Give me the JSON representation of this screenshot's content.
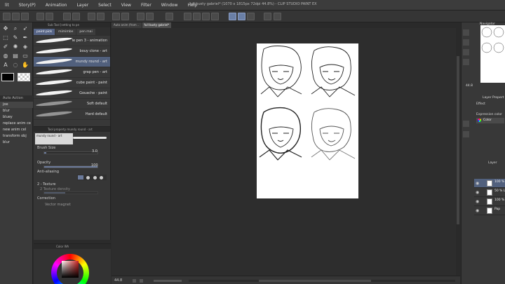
{
  "app": {
    "title": "full busty gabriel* (1070 x 1815px 72dpi 44.8%) - CLIP STUDIO PAINT EX"
  },
  "menu": [
    "lit",
    "Story(P)",
    "Animation",
    "Layer",
    "Select",
    "View",
    "Filter",
    "Window",
    "Help"
  ],
  "left_panel": {
    "sub_tool_header": "Auto Action",
    "sub_tool_value": "joe",
    "actions": [
      "blur",
      "bluey",
      "replace anim ce",
      "new anim cel",
      "transform obj",
      "blur"
    ]
  },
  "brush_panel": {
    "header": "Sub Tool [setting to pe",
    "tabs": [
      "paint pick",
      "mimimbe",
      "pen mai"
    ],
    "brushes": [
      {
        "name": "le pen 3 - animation",
        "selected": false
      },
      {
        "name": "bouy clone - art",
        "selected": false
      },
      {
        "name": "mundy round - art",
        "selected": true
      },
      {
        "name": "grap pen - art",
        "selected": false
      },
      {
        "name": "cube paint - paint",
        "selected": false
      },
      {
        "name": "Gouache - paint",
        "selected": false
      },
      {
        "name": "Soft default",
        "selected": false
      },
      {
        "name": "Hard default",
        "selected": false
      }
    ]
  },
  "tool_property": {
    "header": "Tool property mundy round - art",
    "brush_name": "mundy round - art",
    "brush_size_label": "Brush Size",
    "brush_size_value": "3.0",
    "brush_size_fraction": 0.04,
    "opacity_label": "Opacity",
    "opacity_value": "100",
    "opacity_fraction": 1.0,
    "antialias_label": "Anti-aliasing",
    "texture_label": "2 - Texture",
    "texture_density_label": "2 Texture density",
    "correction_label": "Correction",
    "vector_magnet_label": "Vector magnet"
  },
  "color_panel": {
    "header": "Color Wh"
  },
  "document_tabs": [
    {
      "label": "Auto anim (from ..",
      "selected": false
    },
    {
      "label": "full busty gabriel*",
      "selected": true
    }
  ],
  "canvas_status": {
    "zoom": "44.8"
  },
  "right_panel": {
    "navigator_label": "Navigator",
    "nav_zoom": "44.8",
    "layer_property_label": "Layer Propert",
    "effect_label": "Effect",
    "expression_color_label": "Expression color",
    "expression_color_value": "Color",
    "layer_panel_label": "Layer",
    "layers": [
      {
        "name": "100 % Layer",
        "selected": true
      },
      {
        "name": "50 % Layer",
        "selected": false
      },
      {
        "name": "100 % Fold",
        "selected": false
      },
      {
        "name": "Pap",
        "selected": false
      }
    ]
  },
  "colors": {
    "accent": "#51607d",
    "panel_bg": "#383838",
    "canvas_bg": "#2d2d2d",
    "page": "#ffffff"
  }
}
